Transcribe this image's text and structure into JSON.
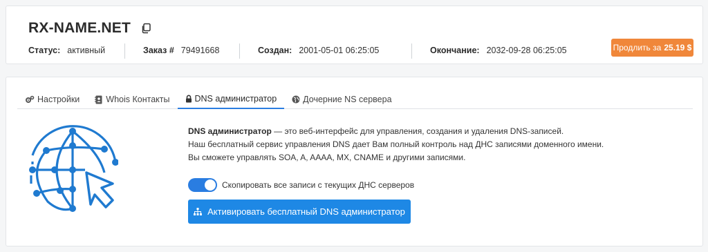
{
  "domain": {
    "name": "RX-NAME.NET",
    "copy_icon": "copy-icon"
  },
  "info": {
    "status_label": "Статус:",
    "status_value": "активный",
    "order_label": "Заказ #",
    "order_value": "79491668",
    "created_label": "Создан:",
    "created_value": "2001-05-01 06:25:05",
    "expires_label": "Окончание:",
    "expires_value": "2032-09-28 06:25:05"
  },
  "renew": {
    "label": "Продлить за",
    "price": "25.19 $",
    "color": "#f0873a"
  },
  "tabs": [
    {
      "label": "Настройки",
      "icon": "gears-icon"
    },
    {
      "label": "Whois Контакты",
      "icon": "address-book-icon"
    },
    {
      "label": "DNS администратор",
      "icon": "lock-icon",
      "active": true
    },
    {
      "label": "Дочерние NS сервера",
      "icon": "globe-icon"
    }
  ],
  "dns": {
    "title": "DNS администратор",
    "line1_rest": " — это веб-интерфейс для управления, создания и удаления DNS-записей.",
    "line2": "Наш бесплатный сервис управления DNS дает Вам полный контроль над ДНС записями доменного имени.",
    "line3": "Вы сможете управлять SOA, A, AAAA, MX, CNAME и другими записями.",
    "toggle_label": "Скопировать все записи с текущих ДНС серверов",
    "toggle_on": true,
    "activate_label": "Активировать бесплатный DNS администратор",
    "accent": "#1e88e5"
  }
}
